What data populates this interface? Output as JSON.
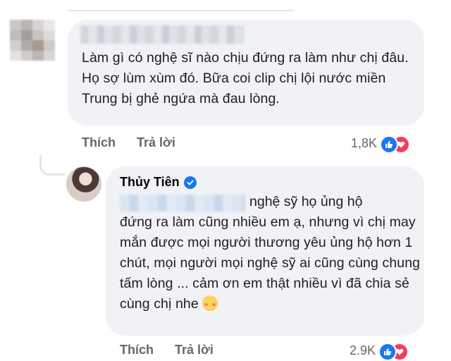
{
  "comment1": {
    "text": "Làm gì có nghệ sĩ nào chịu đứng ra làm như chị đâu. Họ sợ lùm xùm đó. Bữa coi clip chị lội nước miền Trung bị ghẻ ngứa mà đau lòng.",
    "like_label": "Thích",
    "reply_label": "Trả lời",
    "reaction_count": "1,8K"
  },
  "comment2": {
    "author": "Thủy Tiên",
    "text_first": "nghệ sỹ họ ủng hộ",
    "text_rest": "đứng ra làm cũng nhiều em ạ, nhưng vì chị may mắn được mọi người thương yêu ủng hộ hơn 1 chút, mọi người mọi nghệ sỹ ai cũng cùng chung tấm lòng ... cảm ơn em thật nhiều vì đã chia sẻ cùng chị nhe",
    "like_label": "Thích",
    "reply_label": "Trả lời",
    "reaction_count": "2.9K"
  },
  "icons": {
    "like": "like-reaction-icon",
    "love": "love-reaction-icon",
    "verified": "verified-badge-icon",
    "emoji": "smiling-face-with-hearts"
  },
  "colors": {
    "bubble": "#f0f2f5",
    "like_blue": "#1877f2",
    "love_red": "#f33e58",
    "muted_text": "#65676b"
  }
}
